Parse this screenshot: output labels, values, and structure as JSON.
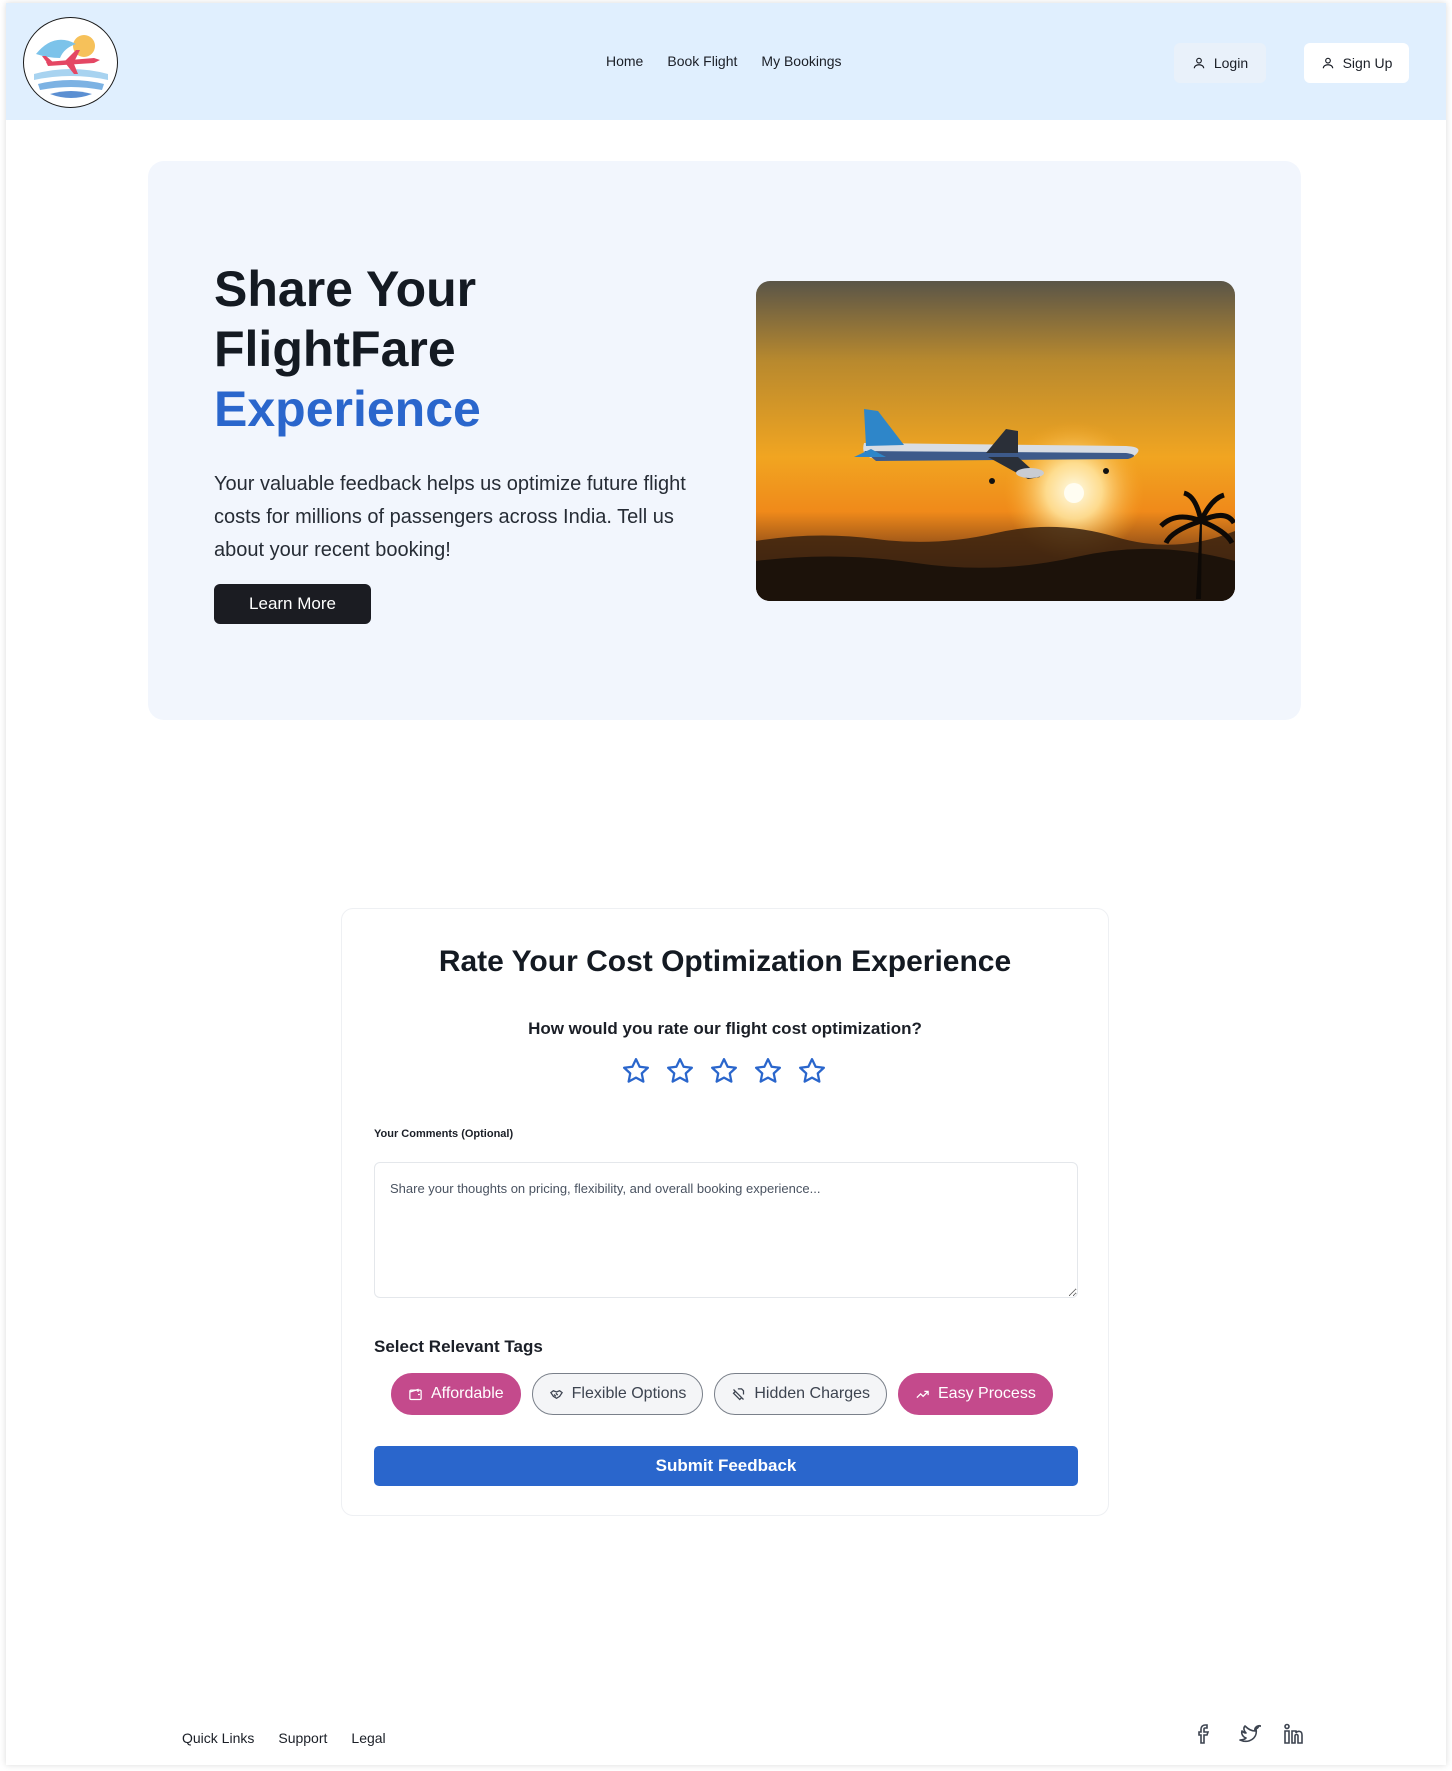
{
  "header": {
    "nav": [
      "Home",
      "Book Flight",
      "My Bookings"
    ],
    "login_label": "Login",
    "signup_label": "Sign Up"
  },
  "hero": {
    "title_line1": "Share Your",
    "title_line2": "FlightFare",
    "title_accent": "Experience",
    "description": "Your valuable feedback helps us optimize future flight costs for millions of passengers across India. Tell us about your recent booking!",
    "learn_more_label": "Learn More"
  },
  "feedback": {
    "title": "Rate Your Cost Optimization Experience",
    "question": "How would you rate our flight cost optimization?",
    "rating": 0,
    "rating_max": 5,
    "comments_label": "Your Comments (Optional)",
    "comments_placeholder": "Share your thoughts on pricing, flexibility, and overall booking experience...",
    "tags_label": "Select Relevant Tags",
    "tags": [
      {
        "label": "Affordable",
        "icon": "wallet-icon",
        "selected": true
      },
      {
        "label": "Flexible Options",
        "icon": "handshake-icon",
        "selected": false
      },
      {
        "label": "Hidden Charges",
        "icon": "hidden-charges-icon",
        "selected": false
      },
      {
        "label": "Easy Process",
        "icon": "trending-up-icon",
        "selected": true
      }
    ],
    "submit_label": "Submit Feedback"
  },
  "footer": {
    "links": [
      "Quick Links",
      "Support",
      "Legal"
    ],
    "social": [
      "facebook-icon",
      "twitter-icon",
      "linkedin-icon"
    ]
  },
  "colors": {
    "header_bg": "#e0effe",
    "accent_blue": "#2a66cc",
    "tag_pink": "#c44a8c",
    "hero_bg": "#f2f6fd",
    "dark_button": "#1b1c22"
  }
}
